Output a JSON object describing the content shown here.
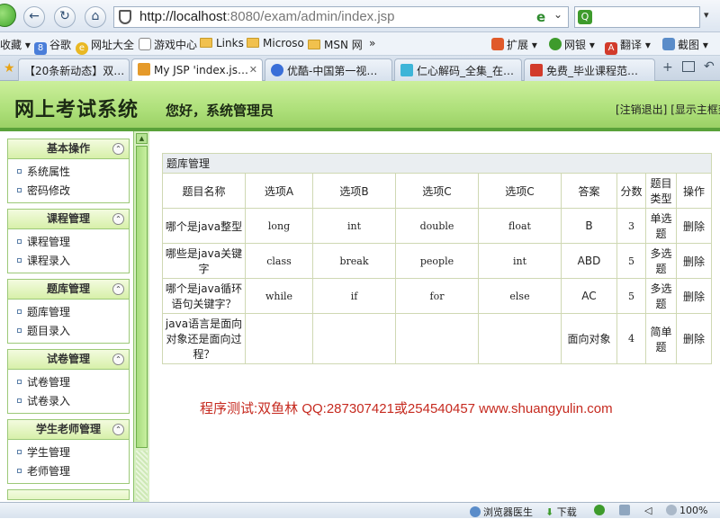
{
  "browser": {
    "url": "http://localhost:8080/exam/admin/index.jsp",
    "url_display_host": "http://localhost",
    "url_display_rest": ":8080/exam/admin/index.jsp",
    "search_placeholder": ""
  },
  "favorites_bar": {
    "items": [
      {
        "label": "收藏",
        "icon": "star-icon"
      },
      {
        "label": "谷歌",
        "icon": "google-icon"
      },
      {
        "label": "网址大全",
        "icon": "hao-icon"
      },
      {
        "label": "游戏中心",
        "icon": "page-icon"
      },
      {
        "label": "Links",
        "icon": "folder-icon"
      },
      {
        "label": "Microso",
        "icon": "folder-icon"
      },
      {
        "label": "MSN 网",
        "icon": "folder-icon"
      }
    ],
    "overflow": "»",
    "tools": [
      {
        "label": "扩展",
        "icon": "grid-icon"
      },
      {
        "label": "网银",
        "icon": "shield-icon"
      },
      {
        "label": "翻译",
        "icon": "translate-icon"
      },
      {
        "label": "截图",
        "icon": "scissors-icon"
      }
    ]
  },
  "tabs": [
    {
      "label": "【20条新动态】双…",
      "active": false
    },
    {
      "label": "My JSP 'index.js…",
      "active": true
    },
    {
      "label": "优酷-中国第一视…",
      "active": false
    },
    {
      "label": "仁心解码_全集_在…",
      "active": false
    },
    {
      "label": "免费_毕业课程范…",
      "active": false
    }
  ],
  "header": {
    "title": "网上考试系统",
    "welcome": "您好，系统管理员",
    "logout": "[注销退出]",
    "show_frame": "[显示主框架"
  },
  "sidebar": {
    "panels": [
      {
        "title": "基本操作",
        "items": [
          "系统属性",
          "密码修改"
        ]
      },
      {
        "title": "课程管理",
        "items": [
          "课程管理",
          "课程录入"
        ]
      },
      {
        "title": "题库管理",
        "items": [
          "题库管理",
          "题目录入"
        ]
      },
      {
        "title": "试卷管理",
        "items": [
          "试卷管理",
          "试卷录入"
        ]
      },
      {
        "title": "学生老师管理",
        "items": [
          "学生管理",
          "老师管理"
        ]
      }
    ],
    "collapse_glyph": "⌃"
  },
  "table": {
    "caption": "题库管理",
    "columns": [
      "题目名称",
      "选项A",
      "选项B",
      "选项C",
      "选项C",
      "答案",
      "分数",
      "题目类型",
      "操作"
    ],
    "rows": [
      [
        "哪个是java整型",
        "long",
        "int",
        "double",
        "float",
        "B",
        "3",
        "单选题",
        "删除"
      ],
      [
        "哪些是java关键字",
        "class",
        "break",
        "people",
        "int",
        "ABD",
        "5",
        "多选题",
        "删除"
      ],
      [
        "哪个是java循环语句关键字？",
        "while",
        "if",
        "for",
        "else",
        "AC",
        "5",
        "多选题",
        "删除"
      ],
      [
        "java语言是面向对象还是面向过程？",
        "",
        "",
        "",
        "",
        "面向对象",
        "4",
        "简单题",
        "删除"
      ]
    ]
  },
  "credit": "程序测试:双鱼林 QQ:287307421或254540457 www.shuangyulin.com",
  "status_bar": {
    "doctor": "浏览器医生",
    "download": "下载",
    "zoom": "100%"
  }
}
